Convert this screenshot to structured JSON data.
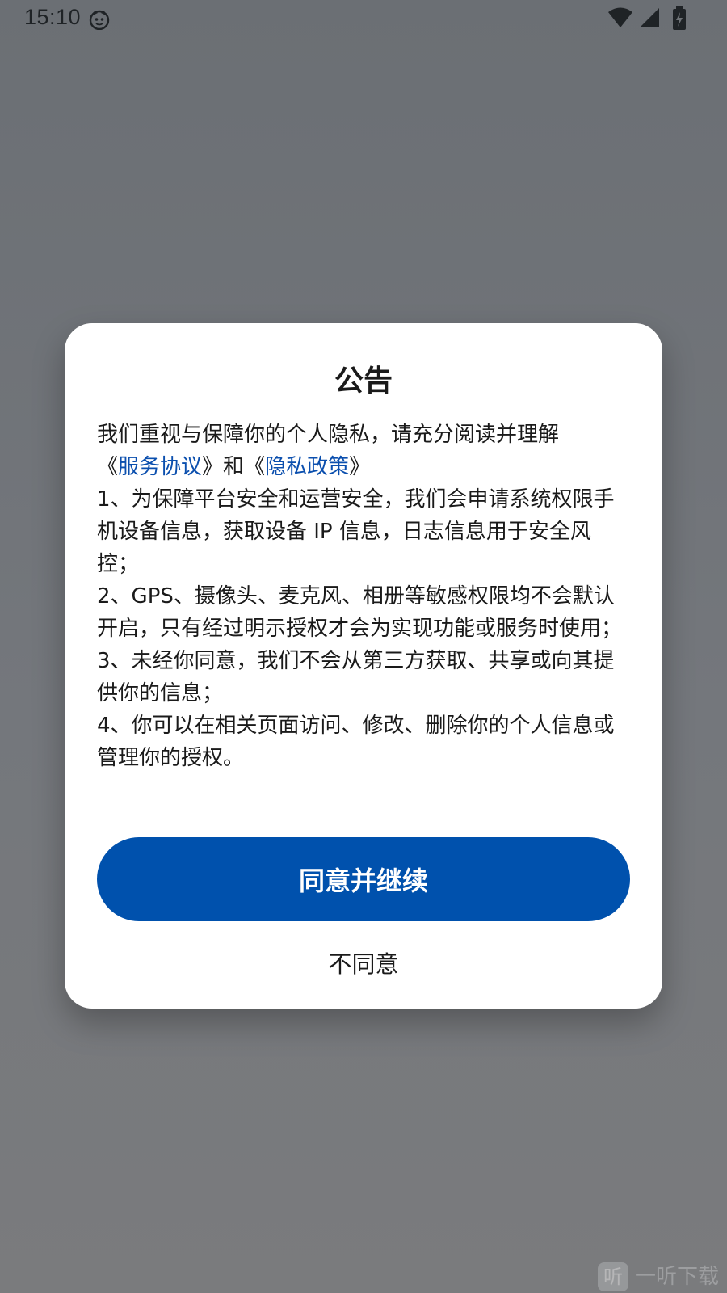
{
  "status_bar": {
    "time": "15:10"
  },
  "icons": {
    "status_app": "cat-face-icon",
    "wifi": "wifi-icon",
    "signal": "cell-signal-icon",
    "battery": "battery-charging-icon"
  },
  "colors": {
    "accent": "#0051ad",
    "link": "#0b4fae",
    "overlay": "#6f7377",
    "dialog_bg": "#ffffff"
  },
  "dialog": {
    "title": "公告",
    "intro": "我们重视与保障你的个人隐私，请充分阅读并理解",
    "quote_open_1": "《",
    "service_agreement": "服务协议",
    "quote_close_1": "》",
    "and": "和",
    "quote_open_2": "《",
    "privacy_policy": "隐私政策",
    "quote_close_2": "》",
    "items": [
      "1、为保障平台安全和运营安全，我们会申请系统权限手机设备信息，获取设备 IP 信息，日志信息用于安全风控；",
      "2、GPS、摄像头、麦克风、相册等敏感权限均不会默认开启，只有经过明示授权才会为实现功能或服务时使用；",
      "3、未经你同意，我们不会从第三方获取、共享或向其提供你的信息；",
      "4、你可以在相关页面访问、修改、删除你的个人信息或管理你的授权。"
    ],
    "agree_button": "同意并继续",
    "disagree_button": "不同意"
  },
  "watermark": {
    "logo": "听",
    "text": "一听下载"
  }
}
